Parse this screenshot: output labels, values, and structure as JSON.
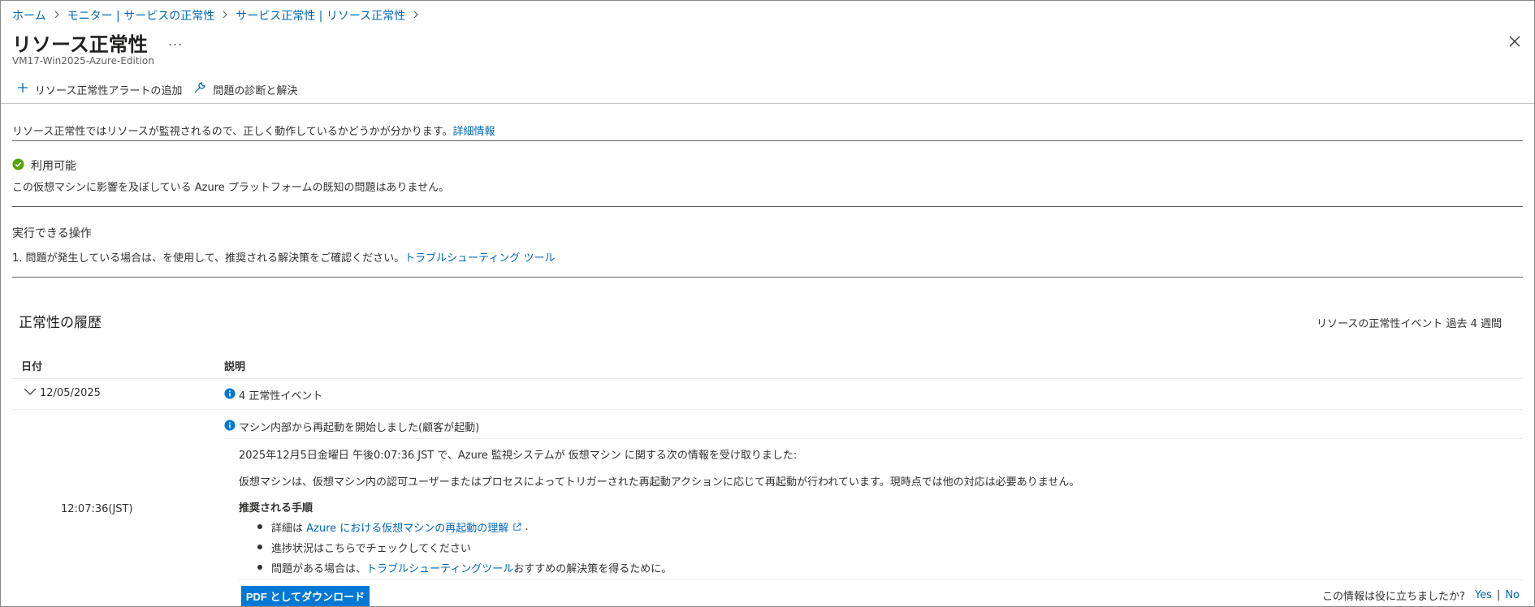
{
  "breadcrumb": {
    "items": [
      "ホーム",
      "モニター | サービスの正常性",
      "サービス正常性 | リソース正常性"
    ],
    "separator": ">"
  },
  "header": {
    "title": "リソース正常性",
    "more_label": "...",
    "subtitle": "VM17-Win2025-Azure-Edition"
  },
  "toolbar": {
    "add_alert_label": "リソース正常性アラートの追加",
    "diagnose_label": "問題の診断と解決"
  },
  "info": {
    "text": "リソース正常性ではリソースが監視されるので、正しく動作しているかどうかが分かります。",
    "link": "詳細情報"
  },
  "status": {
    "label": "利用可能",
    "description": "この仮想マシンに影響を及ぼしている Azure プラットフォームの既知の問題はありません。",
    "color": "#57a300"
  },
  "actions": {
    "title": "実行できる操作",
    "item_text": "1.  問題が発生している場合は、を使用して、推奨される解決策をご確認ください。",
    "item_link": "トラブルシューティング ツール"
  },
  "history": {
    "title": "正常性の履歴",
    "range": "リソースの正常性イベント 過去 4 週間",
    "columns": {
      "date": "日付",
      "description": "説明"
    },
    "group": {
      "date": "12/05/2025",
      "summary": "4 正常性イベント"
    },
    "event": {
      "title": "マシン内部から再起動を開始しました(顧客が起動)",
      "time": "12:07:36(JST)",
      "line1": "2025年12月5日金曜日 午後0:07:36 JST で、Azure 監視システムが 仮想マシン に関する次の情報を受け取りました:",
      "line2": "仮想マシンは、仮想マシン内の認可ユーザーまたはプロセスによってトリガーされた再起動アクションに応じて再起動が行われています。現時点では他の対応は必要ありません。",
      "steps_title": "推奨される手順",
      "step1_prefix": "詳細は",
      "step1_link": "Azure における仮想マシンの再起動の理解",
      "step1_suffix": ".",
      "step2": "進捗状況はこちらでチェックしてください",
      "step3_prefix": "問題がある場合は、",
      "step3_link": "トラブルシューティングツール",
      "step3_suffix": " おすすめの解決策を得るために。"
    },
    "pdf_button": "PDF としてダウンロード",
    "feedback": {
      "question": "この情報は役に立ちましたか?",
      "yes": "Yes",
      "separator": "|",
      "no": "No"
    }
  },
  "colors": {
    "link": "#0067b8",
    "primary_button": "#0078d4",
    "info_icon": "#0078d4"
  },
  "icons": [
    "chevron-right-icon",
    "more-icon",
    "close-icon",
    "plus-icon",
    "wrench-icon",
    "check-circle-icon",
    "chevron-down-icon",
    "info-icon",
    "external-link-icon"
  ]
}
